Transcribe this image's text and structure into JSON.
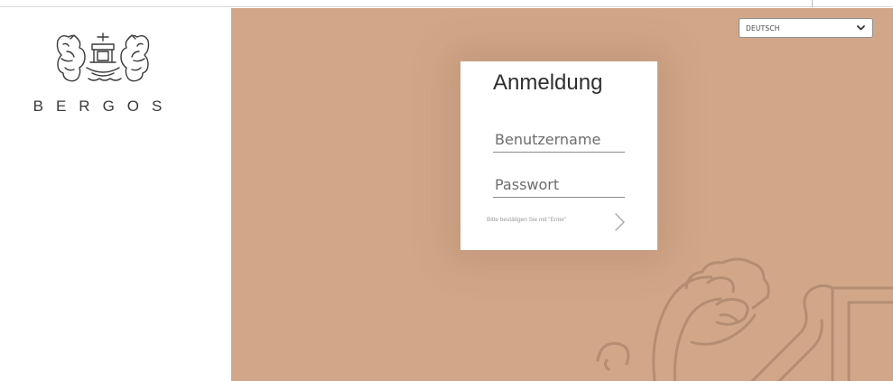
{
  "brand": {
    "name": "BERGOS"
  },
  "language": {
    "selected": "DEUTSCH"
  },
  "login": {
    "title": "Anmeldung",
    "username_placeholder": "Benutzername",
    "password_placeholder": "Passwort",
    "hint": "Bitte bestätigen Sie mit \"Enter\""
  },
  "colors": {
    "background_accent": "#d2a689",
    "card": "#ffffff",
    "text_dark": "#2f2f2f"
  },
  "icons": [
    "bergos-logo-icon",
    "chevron-down-icon",
    "chevron-right-icon",
    "lion-emblem-icon"
  ]
}
